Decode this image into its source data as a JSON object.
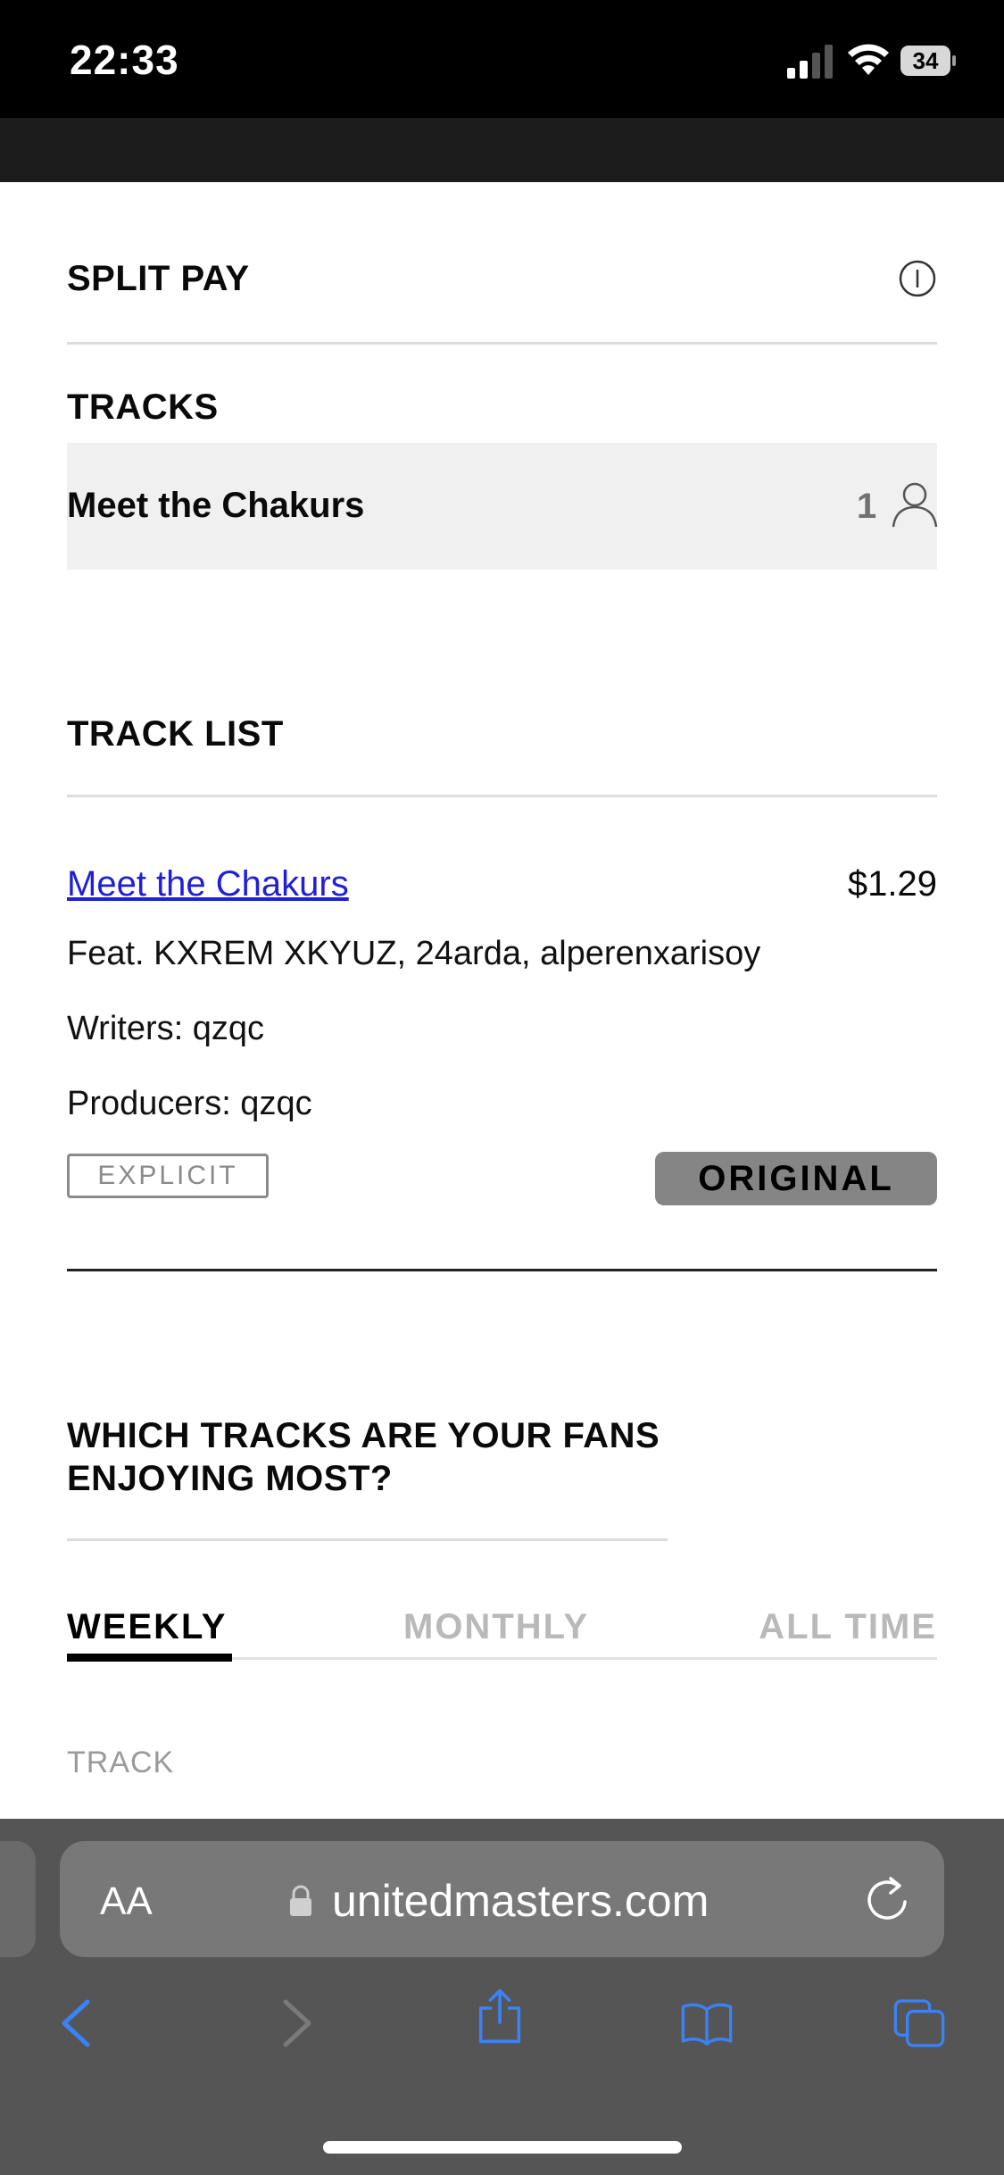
{
  "status_bar": {
    "time": "22:33",
    "battery": "34"
  },
  "split_pay": {
    "title": "SPLIT PAY"
  },
  "tracks_section": {
    "title": "TRACKS",
    "items": [
      {
        "name": "Meet the Chakurs",
        "collaborator_count": "1"
      }
    ]
  },
  "track_list": {
    "title": "TRACK LIST",
    "track": {
      "name": "Meet the Chakurs",
      "price": "$1.29",
      "featuring": "Feat. KXREM XKYUZ, 24arda, alperenxarisoy",
      "writers": "Writers: qzqc",
      "producers": "Producers: qzqc",
      "explicit_label": "EXPLICIT",
      "original_label": "ORIGINAL"
    }
  },
  "fans_section": {
    "title": "WHICH TRACKS ARE YOUR FANS ENJOYING MOST?",
    "tabs": [
      {
        "label": "WEEKLY",
        "active": true
      },
      {
        "label": "MONTHLY",
        "active": false
      },
      {
        "label": "ALL TIME",
        "active": false
      }
    ],
    "column_header": "TRACK"
  },
  "browser": {
    "aa_label": "AA",
    "url": "unitedmasters.com",
    "icons": [
      "back-icon",
      "forward-icon",
      "share-icon",
      "bookmarks-icon",
      "tabs-icon",
      "reload-icon",
      "lock-icon"
    ],
    "accent_color": "#3b82f6"
  }
}
